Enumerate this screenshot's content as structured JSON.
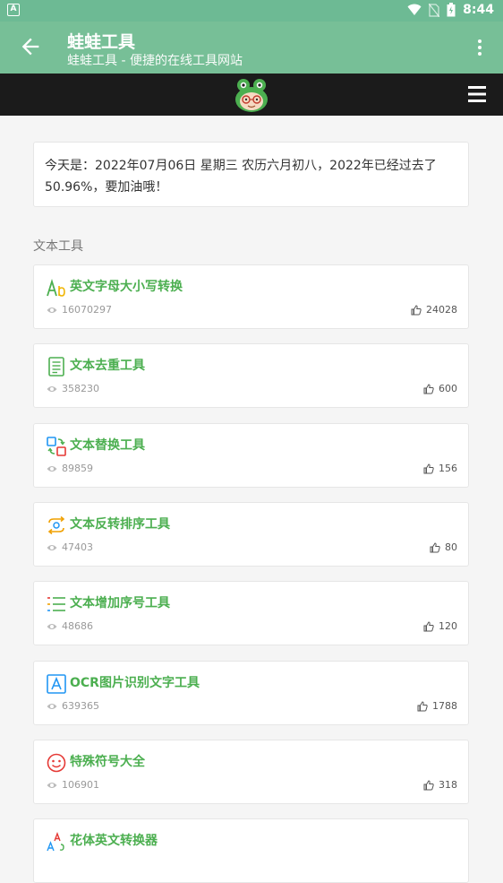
{
  "status_bar": {
    "time": "8:44",
    "notification_icon": "app-notification-icon"
  },
  "app_bar": {
    "title": "蛙蛙工具",
    "subtitle": "蛙蛙工具 - 便捷的在线工具网站"
  },
  "date_notice": "今天是：2022年07月06日 星期三 农历六月初八，2022年已经过去了50.96%，要加油哦！",
  "section": {
    "title": "文本工具"
  },
  "tools": [
    {
      "name": "英文字母大小写转换",
      "views": "16070297",
      "likes": "24028",
      "icon": "letter-case-icon"
    },
    {
      "name": "文本去重工具",
      "views": "358230",
      "likes": "600",
      "icon": "document-list-icon"
    },
    {
      "name": "文本替换工具",
      "views": "89859",
      "likes": "156",
      "icon": "replace-icon"
    },
    {
      "name": "文本反转排序工具",
      "views": "47403",
      "likes": "80",
      "icon": "reverse-icon"
    },
    {
      "name": "文本增加序号工具",
      "views": "48686",
      "likes": "120",
      "icon": "numbered-list-icon"
    },
    {
      "name": "OCR图片识别文字工具",
      "views": "639365",
      "likes": "1788",
      "icon": "ocr-icon"
    },
    {
      "name": "特殊符号大全",
      "views": "106901",
      "likes": "318",
      "icon": "smiley-icon"
    },
    {
      "name": "花体英文转换器",
      "views": "",
      "likes": "",
      "icon": "fancy-letters-icon"
    }
  ],
  "colors": {
    "app_bar": "#77bf97",
    "status_bar": "#6dba94",
    "nav_bar": "#1b1b1b",
    "accent_green": "#4caf50"
  }
}
